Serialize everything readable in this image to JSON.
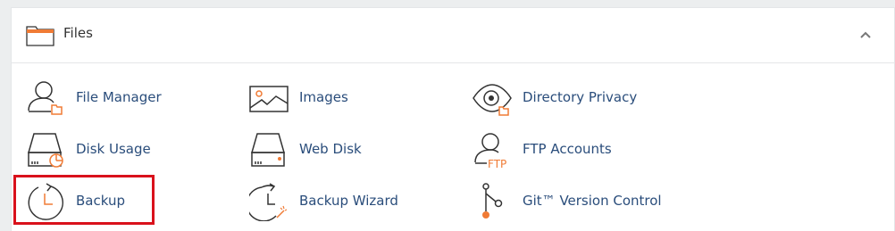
{
  "section": {
    "title": "Files",
    "icons": {
      "section": "folder-icon",
      "collapse": "chevron-up-icon"
    },
    "accent_color": "#f07b35",
    "link_color": "#2a4d7b",
    "highlight_color": "#d9111b"
  },
  "tools": [
    {
      "label": "File Manager",
      "icon": "file-manager-icon"
    },
    {
      "label": "Images",
      "icon": "images-icon"
    },
    {
      "label": "Directory Privacy",
      "icon": "directory-privacy-icon"
    },
    {
      "label": "Disk Usage",
      "icon": "disk-usage-icon"
    },
    {
      "label": "Web Disk",
      "icon": "web-disk-icon"
    },
    {
      "label": "FTP Accounts",
      "icon": "ftp-accounts-icon",
      "icon_text": "FTP"
    },
    {
      "label": "Backup",
      "icon": "backup-icon",
      "highlighted": true
    },
    {
      "label": "Backup Wizard",
      "icon": "backup-wizard-icon"
    },
    {
      "label": "Git™ Version Control",
      "icon": "git-version-control-icon"
    }
  ]
}
